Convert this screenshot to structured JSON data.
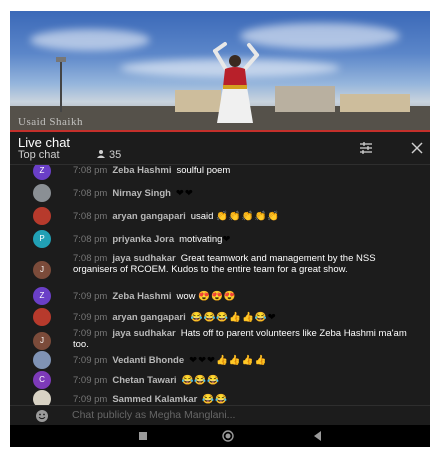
{
  "video": {
    "watermark": "Usaid Shaikh"
  },
  "chat_header": {
    "title": "Live chat",
    "mode_label": "Top chat",
    "viewer_count": "35"
  },
  "messages": [
    {
      "time": "7:08 pm",
      "author": "Zeba Hashmi",
      "text": "soulful poem",
      "emoji": "",
      "avatar_letter": "Z",
      "avatar_color": "#6a3fc7"
    },
    {
      "time": "7:08 pm",
      "author": "Nirnay Singh",
      "text": "",
      "emoji": "❤❤",
      "avatar_letter": "",
      "avatar_color": "#8a8f94"
    },
    {
      "time": "7:08 pm",
      "author": "aryan gangapari",
      "text": "usaid",
      "emoji": "👏👏👏👏👏",
      "avatar_letter": "",
      "avatar_color": "#b73a2c"
    },
    {
      "time": "7:08 pm",
      "author": "priyanka Jora",
      "text": "motivating",
      "emoji": "❤",
      "avatar_letter": "P",
      "avatar_color": "#21a0b5"
    },
    {
      "time": "7:08 pm",
      "author": "jaya sudhakar",
      "text": "Great teamwork and management by the NSS organisers of RCOEM. Kudos to the entire team for a great show.",
      "emoji": "",
      "avatar_letter": "J",
      "avatar_color": "#7b4b3a"
    },
    {
      "time": "7:09 pm",
      "author": "Zeba Hashmi",
      "text": "wow",
      "emoji": "😍😍😍",
      "avatar_letter": "Z",
      "avatar_color": "#6a3fc7"
    },
    {
      "time": "7:09 pm",
      "author": "aryan gangapari",
      "text": "",
      "emoji": "😂😂😂👍👍😂❤",
      "avatar_letter": "",
      "avatar_color": "#b73a2c"
    },
    {
      "time": "7:09 pm",
      "author": "jaya sudhakar",
      "text": "Hats off to parent volunteers like Zeba Hashmi ma'am too.",
      "emoji": "",
      "avatar_letter": "J",
      "avatar_color": "#7b4b3a"
    },
    {
      "time": "7:09 pm",
      "author": "Vedanti Bhonde",
      "text": "",
      "emoji": "❤❤❤👍👍👍👍",
      "avatar_letter": "",
      "avatar_color": "#7f93b5"
    },
    {
      "time": "7:09 pm",
      "author": "Chetan Tawari",
      "text": "",
      "emoji": "😂😂😂",
      "avatar_letter": "C",
      "avatar_color": "#7d3ab8"
    },
    {
      "time": "7:09 pm",
      "author": "Sammed Kalamkar",
      "text": "",
      "emoji": "😂😂",
      "avatar_letter": "",
      "avatar_color": "#d8d2c4"
    }
  ],
  "chat_input": {
    "placeholder": "Chat publicly as Megha Manglani..."
  },
  "colors": {
    "background": "#1c1c1c",
    "accent_red": "#c4302b",
    "timestamp": "#777777",
    "author": "#b8b8b8"
  },
  "icons": {
    "viewers": "person-icon",
    "filter": "filter-icon",
    "close": "close-icon",
    "emoji": "smiley-icon",
    "nav_recents": "recents-icon",
    "nav_home": "home-icon",
    "nav_back": "back-icon"
  }
}
